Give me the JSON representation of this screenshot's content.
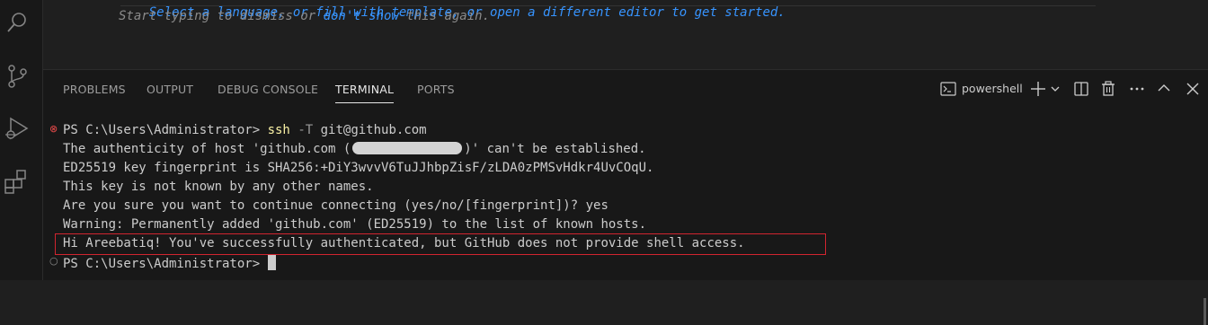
{
  "editor": {
    "hint_line1": "Select a language, or fill with template, or open a different editor to get started.",
    "hint_line2_prefix": "Start typing to dismiss or ",
    "hint_line2_link": "don't show",
    "hint_line2_suffix": " this again."
  },
  "activity_bar": {
    "icons": [
      "search-icon",
      "source-control-icon",
      "run-debug-icon",
      "extensions-icon"
    ]
  },
  "panel": {
    "tabs": [
      {
        "label": "PROBLEMS",
        "active": false
      },
      {
        "label": "OUTPUT",
        "active": false
      },
      {
        "label": "DEBUG CONSOLE",
        "active": false
      },
      {
        "label": "TERMINAL",
        "active": true
      },
      {
        "label": "PORTS",
        "active": false
      }
    ],
    "shell_label": "powershell",
    "actions": [
      "terminal-icon",
      "add-icon",
      "chevron-down-icon",
      "split-icon",
      "trash-icon",
      "more-icon",
      "maximize-icon",
      "close-icon"
    ]
  },
  "terminal": {
    "prompt1": "PS C:\\Users\\Administrator> ",
    "cmd": "ssh",
    "flag": "-T",
    "cmd_arg": "git@github.com",
    "line2_prefix": "The authenticity of host 'github.com (",
    "line2_suffix": ")' can't be established.",
    "line3": "ED25519 key fingerprint is SHA256:+DiY3wvvV6TuJJhbpZisF/zLDA0zPMSvHdkr4UvCOqU.",
    "line4": "This key is not known by any other names.",
    "line5": "Are you sure you want to continue connecting (yes/no/[fingerprint])? yes",
    "line6": "Warning: Permanently added 'github.com' (ED25519) to the list of known hosts.",
    "line7": "Hi Areebatiq! You've successfully authenticated, but GitHub does not provide shell access.",
    "prompt2": "PS C:\\Users\\Administrator> ",
    "decoration_error_color": "#f14c4c",
    "decoration_default_color": "#8b8b8b"
  },
  "colors": {
    "accent_link": "#3794ff",
    "command_yellow": "#f9f1a5",
    "highlight_box": "#d1242f"
  }
}
